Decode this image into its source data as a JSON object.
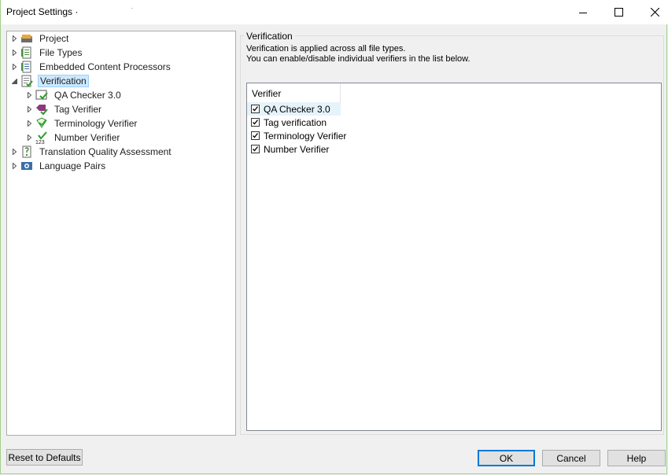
{
  "window": {
    "title": "Project Settings ·",
    "controls": [
      "minimize-icon",
      "maximize-icon",
      "close-icon"
    ]
  },
  "tree": {
    "items": [
      {
        "label": "Project",
        "icon": "project-icon",
        "expander": "collapsed"
      },
      {
        "label": "File Types",
        "icon": "file-types-icon",
        "expander": "collapsed"
      },
      {
        "label": "Embedded Content Processors",
        "icon": "embedded-content-icon",
        "expander": "collapsed"
      },
      {
        "label": "Verification",
        "icon": "verification-icon",
        "expander": "expanded",
        "selected": true
      },
      {
        "label": "QA Checker 3.0",
        "icon": "qa-checker-icon",
        "expander": "collapsed"
      },
      {
        "label": "Tag Verifier",
        "icon": "tag-verifier-icon",
        "expander": "collapsed"
      },
      {
        "label": "Terminology Verifier",
        "icon": "terminology-verifier-icon",
        "expander": "collapsed"
      },
      {
        "label": "Number Verifier",
        "icon": "number-verifier-icon",
        "expander": "collapsed"
      },
      {
        "label": "Translation Quality Assessment",
        "icon": "tqa-icon",
        "expander": "collapsed"
      },
      {
        "label": "Language Pairs",
        "icon": "language-pairs-icon",
        "expander": "collapsed"
      }
    ]
  },
  "panel": {
    "group_title": "Verification",
    "desc_line1": "Verification is applied across all file types.",
    "desc_line2": "You can enable/disable individual verifiers in the list below.",
    "list_header": "Verifier",
    "verifiers": [
      {
        "label": "QA Checker 3.0",
        "checked": true
      },
      {
        "label": "Tag verification",
        "checked": true
      },
      {
        "label": "Terminology Verifier",
        "checked": true
      },
      {
        "label": "Number Verifier",
        "checked": true
      }
    ]
  },
  "buttons": {
    "reset": "Reset to Defaults",
    "ok": "OK",
    "cancel": "Cancel",
    "help": "Help"
  },
  "colors": {
    "selection": "#cce8ff",
    "default_button_border": "#0078d7",
    "window_border": "#9fd18c"
  }
}
